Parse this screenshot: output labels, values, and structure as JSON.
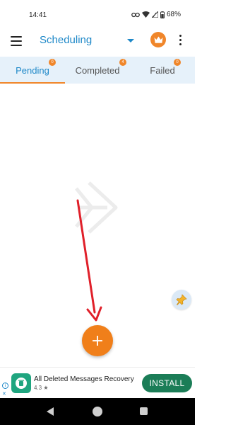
{
  "status_bar": {
    "time": "14:41",
    "battery": "68%"
  },
  "header": {
    "title": "Scheduling",
    "menu_icon": "hamburger-menu-icon",
    "dropdown_icon": "caret-down-icon",
    "premium_icon": "crown-icon",
    "more_icon": "more-vertical-icon"
  },
  "tabs": [
    {
      "label": "Pending",
      "badge": "0",
      "active": true
    },
    {
      "label": "Completed",
      "badge": "4",
      "active": false
    },
    {
      "label": "Failed",
      "badge": "0",
      "active": false
    }
  ],
  "fab": {
    "add_label": "+",
    "pin_icon": "pushpin-icon"
  },
  "ad": {
    "title": "All Deleted Messages Recovery",
    "rating": "4.3 ★",
    "cta": "INSTALL"
  },
  "colors": {
    "accent": "#f0862a",
    "primary": "#1e88c8",
    "annotation_arrow": "#e0202a",
    "install_button": "#1b7d57"
  }
}
